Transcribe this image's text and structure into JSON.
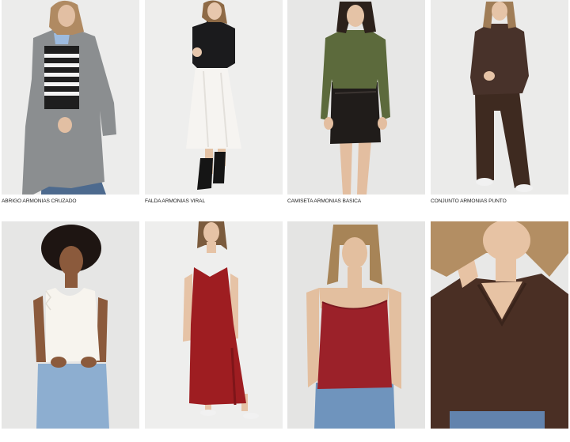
{
  "products": [
    {
      "name": "ABRIGO ARMONIAS CRUZADO",
      "image": "woman-gray-coat-striped-sweater"
    },
    {
      "name": "FALDA ARMONIAS VIRAL",
      "image": "woman-black-turtleneck-white-satin-skirt"
    },
    {
      "name": "CAMISETA ARMONIAS BÁSICA",
      "image": "woman-olive-top-black-leather-skirt"
    },
    {
      "name": "CONJUNTO ARMONIAS PUNTO",
      "image": "woman-brown-knit-set"
    },
    {
      "name": "",
      "image": "woman-white-lace-top-jeans"
    },
    {
      "name": "",
      "image": "woman-red-slip-dress"
    },
    {
      "name": "",
      "image": "woman-red-lace-camisole-jeans"
    },
    {
      "name": "",
      "image": "woman-brown-v-neck-sweater-closeup"
    }
  ]
}
